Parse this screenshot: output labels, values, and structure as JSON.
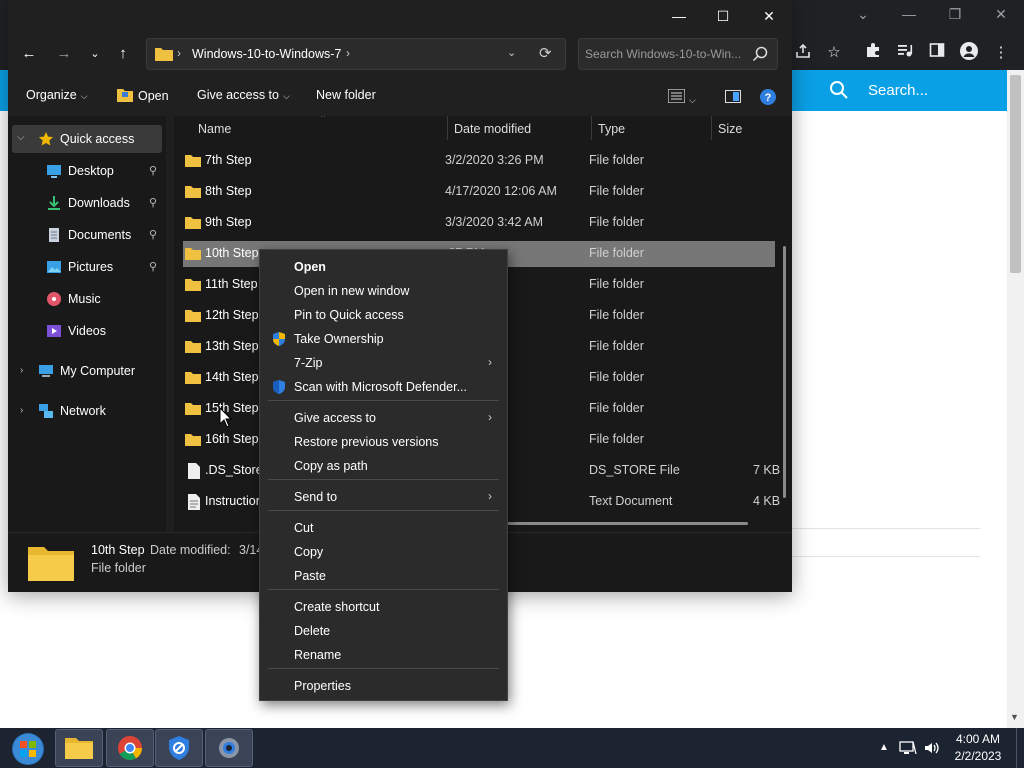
{
  "browser": {
    "search_label": "Search...",
    "icons": [
      "share-icon",
      "star-icon",
      "extensions-icon",
      "media-icon",
      "sidebar-icon",
      "profile-icon",
      "more-icon"
    ]
  },
  "explorer": {
    "address": {
      "crumb": "Windows-10-to-Windows-7"
    },
    "search": {
      "placeholder": "Search Windows-10-to-Win..."
    },
    "ribbon": {
      "organize": "Organize",
      "open": "Open",
      "give_access": "Give access to",
      "new_folder": "New folder"
    },
    "nav": {
      "quick_access": "Quick access",
      "desktop": "Desktop",
      "downloads": "Downloads",
      "documents": "Documents",
      "pictures": "Pictures",
      "music": "Music",
      "videos": "Videos",
      "my_computer": "My Computer",
      "network": "Network"
    },
    "columns": {
      "name": "Name",
      "date": "Date modified",
      "type": "Type",
      "size": "Size"
    },
    "files": [
      {
        "name": "7th Step",
        "date": "3/2/2020 3:26 PM",
        "type": "File folder",
        "size": ""
      },
      {
        "name": "8th Step",
        "date": "4/17/2020 12:06 AM",
        "type": "File folder",
        "size": ""
      },
      {
        "name": "9th Step",
        "date": "3/3/2020 3:42 AM",
        "type": "File folder",
        "size": ""
      },
      {
        "name": "10th Step",
        "date": ":37 PM",
        "type": "File folder",
        "size": ""
      },
      {
        "name": "11th Step",
        "date": "26 PM",
        "type": "File folder",
        "size": ""
      },
      {
        "name": "12th Step",
        "date": "26 PM",
        "type": "File folder",
        "size": ""
      },
      {
        "name": "13th Step",
        "date": "26 PM",
        "type": "File folder",
        "size": ""
      },
      {
        "name": "14th Step",
        "date": "26 PM",
        "type": "File folder",
        "size": ""
      },
      {
        "name": "15th Step",
        "date": "39 AM",
        "type": "File folder",
        "size": ""
      },
      {
        "name": "16th Step",
        "date": "21 AM",
        "type": "File folder",
        "size": ""
      },
      {
        "name": ".DS_Store",
        "date": "43 PM",
        "type": "DS_STORE File",
        "size": "7 KB"
      },
      {
        "name": "Instruction",
        "date": "15 AM",
        "type": "Text Document",
        "size": "4 KB"
      }
    ],
    "details": {
      "name": "10th Step",
      "modified_label": "Date modified:",
      "modified_value": "3/14",
      "type": "File folder"
    }
  },
  "context_menu": {
    "items": [
      {
        "label": "Open",
        "bold": true
      },
      {
        "label": "Open in new window"
      },
      {
        "label": "Pin to Quick access"
      },
      {
        "label": "Take Ownership",
        "icon": "shield-uac-icon"
      },
      {
        "label": "7-Zip",
        "submenu": true
      },
      {
        "label": "Scan with Microsoft Defender...",
        "icon": "defender-shield-icon"
      },
      {
        "label": "Give access to",
        "submenu": true
      },
      {
        "label": "Restore previous versions"
      },
      {
        "label": "Copy as path"
      },
      {
        "label": "Send to",
        "submenu": true
      },
      {
        "label": "Cut"
      },
      {
        "label": "Copy"
      },
      {
        "label": "Paste"
      },
      {
        "label": "Create shortcut"
      },
      {
        "label": "Delete"
      },
      {
        "label": "Rename"
      },
      {
        "label": "Properties"
      }
    ]
  },
  "taskbar": {
    "time": "4:00 AM",
    "date": "2/2/2023",
    "apps": [
      "start-orb",
      "file-explorer",
      "chrome",
      "defender",
      "settings"
    ]
  },
  "colors": {
    "accent_blue": "#0aa0e6",
    "folder_yellow": "#f0c040",
    "selection": "#777777",
    "menu_bg": "#2b2b2b",
    "taskbar": "#1c2431"
  }
}
